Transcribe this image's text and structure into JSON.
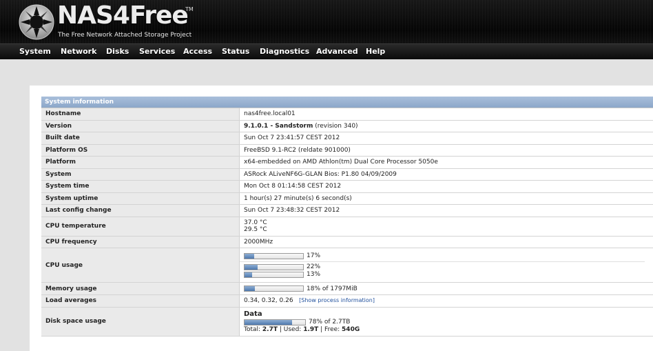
{
  "header": {
    "logo_text": "NAS4Free",
    "logo_tm": "TM",
    "tagline": "The Free Network Attached Storage Project"
  },
  "nav": {
    "items": [
      "System",
      "Network",
      "Disks",
      "Services",
      "Access",
      "Status",
      "Diagnostics",
      "Advanced",
      "Help"
    ]
  },
  "system_info": {
    "title": "System information",
    "hostname": {
      "label": "Hostname",
      "value": "nas4free.local01"
    },
    "version": {
      "label": "Version",
      "value_bold": "9.1.0.1 - Sandstorm",
      "value_rest": " (revision 340)"
    },
    "built_date": {
      "label": "Built date",
      "value": "Sun Oct 7 23:41:57 CEST 2012"
    },
    "platform_os": {
      "label": "Platform OS",
      "value": "FreeBSD 9.1-RC2 (reldate 901000)"
    },
    "platform": {
      "label": "Platform",
      "value": "x64-embedded on AMD Athlon(tm) Dual Core Processor 5050e"
    },
    "system": {
      "label": "System",
      "value": "ASRock ALiveNF6G-GLAN Bios: P1.80 04/09/2009"
    },
    "system_time": {
      "label": "System time",
      "value": "Mon Oct  8 01:14:58 CEST 2012"
    },
    "system_uptime": {
      "label": "System uptime",
      "value": "1 hour(s) 27 minute(s) 6 second(s)"
    },
    "last_config_change": {
      "label": "Last config change",
      "value": "Sun Oct 7 23:48:32 CEST 2012"
    },
    "cpu_temperature": {
      "label": "CPU temperature",
      "values": [
        "37.0  °C",
        "29.5  °C"
      ]
    },
    "cpu_frequency": {
      "label": "CPU frequency",
      "value": "2000MHz"
    },
    "cpu_usage": {
      "label": "CPU usage",
      "total": {
        "percent": 17,
        "text": "17%"
      },
      "cores": [
        {
          "percent": 22,
          "text": "22%"
        },
        {
          "percent": 13,
          "text": "13%"
        }
      ]
    },
    "memory_usage": {
      "label": "Memory usage",
      "percent": 18,
      "text": "18% of 1797MiB"
    },
    "load_averages": {
      "label": "Load averages",
      "value": "0.34, 0.32, 0.26",
      "link": "[Show process information]"
    },
    "disk_space_usage": {
      "label": "Disk space usage",
      "disk_name": "Data",
      "percent": 78,
      "text": "78% of 2.7TB",
      "total_label": "Total: ",
      "total": "2.7T",
      "used_label": " | Used: ",
      "used": "1.9T",
      "free_label": " | Free: ",
      "free": "540G"
    }
  },
  "colors": {
    "accent": "#8ca7c9",
    "bar_fill": "#4f78ad",
    "label_bg": "#eaeaea"
  }
}
